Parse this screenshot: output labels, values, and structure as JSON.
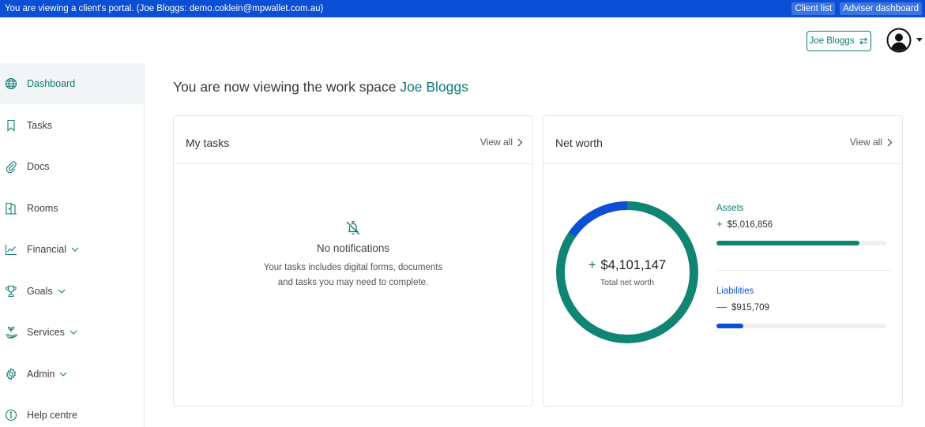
{
  "banner": {
    "message": "You are viewing a client's portal. (Joe Bloggs:  demo.coklein@mpwallet.com.au)",
    "client_list": "Client list",
    "adviser_dashboard": "Adviser dashboard"
  },
  "header": {
    "workspace_button": "Joe Bloggs"
  },
  "sidebar": {
    "items": [
      {
        "label": "Dashboard",
        "icon": "globe-icon"
      },
      {
        "label": "Tasks",
        "icon": "bookmark-icon"
      },
      {
        "label": "Docs",
        "icon": "paperclip-icon"
      },
      {
        "label": "Rooms",
        "icon": "door-icon"
      },
      {
        "label": "Financial",
        "icon": "chart-line-icon"
      },
      {
        "label": "Goals",
        "icon": "trophy-icon"
      },
      {
        "label": "Services",
        "icon": "hand-plant-icon"
      },
      {
        "label": "Admin",
        "icon": "gear-icon"
      },
      {
        "label": "Help centre",
        "icon": "info-icon"
      }
    ]
  },
  "main": {
    "title_prefix": "You are now viewing the work space",
    "title_name": "Joe Bloggs",
    "tasks": {
      "title": "My tasks",
      "view_all": "View all",
      "empty_title": "No notifications",
      "empty_text": "Your tasks includes digital forms, documents and tasks you may need to complete."
    },
    "net_worth": {
      "title": "Net worth",
      "view_all": "View all",
      "total": "$4,101,147",
      "total_label": "Total net worth",
      "assets_label": "Assets",
      "assets_value": "$5,016,856",
      "liabilities_label": "Liabilities",
      "liabilities_value": "$915,709",
      "assets_value_num": 5016856,
      "liabilities_value_num": 915709,
      "assets_bar_pct": 84,
      "liabilities_bar_pct": 16
    }
  },
  "colors": {
    "banner": "#0a4fd6",
    "accent": "#0f7a73",
    "assets": "#108574",
    "liabilities": "#0a4fd6"
  }
}
